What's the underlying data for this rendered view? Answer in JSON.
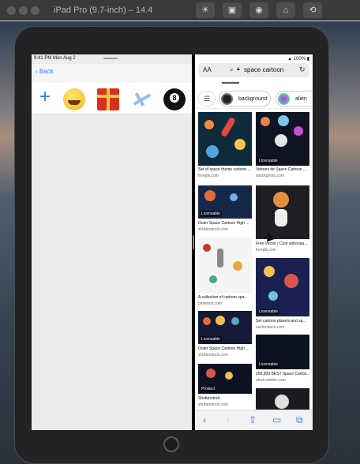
{
  "simulator": {
    "title": "iPad Pro (9.7-inch) – 14.4"
  },
  "left_app": {
    "status_time": "9:41 PM  Mon Aug 2",
    "back_label": "Back",
    "emoji_row": [
      {
        "icon": "plus-icon",
        "glyph": "+"
      },
      {
        "icon": "smile-emoji-icon"
      },
      {
        "icon": "gift-emoji-icon"
      },
      {
        "icon": "airplane-emoji-icon"
      },
      {
        "icon": "eight-ball-emoji-icon"
      }
    ]
  },
  "safari": {
    "status_right": "100%",
    "text_size_label": "AA",
    "search_value": "space cartoon",
    "chips": [
      {
        "label": "background"
      },
      {
        "label": "alien"
      }
    ],
    "results": [
      {
        "caption": "Set of space theme cartoon ...",
        "source": "freepik.com",
        "badge": ""
      },
      {
        "caption": "Vetores de Space Cartoon ...",
        "source": "istockphoto.com",
        "badge": "Licensable"
      },
      {
        "caption": "Outer Space Cartoon High ...",
        "source": "shutterstock.com",
        "badge": "Licensable"
      },
      {
        "caption": "Free Vector | Cute astronau...",
        "source": "freepik.com",
        "badge": ""
      },
      {
        "caption": "A collection of cartoon spa...",
        "source": "pinterest.com",
        "badge": ""
      },
      {
        "caption": "Set cartoon planets and sp...",
        "source": "vectorstock.com",
        "badge": "Licensable"
      },
      {
        "caption": "Outer Space Cartoon High ...",
        "source": "shutterstock.com",
        "badge": "Licensable"
      },
      {
        "caption": "258,909 BEST Space Cartoo...",
        "source": "stock.adobe.com",
        "badge": "Licensable"
      },
      {
        "caption": "Shutterstock",
        "source": "shutterstock.com",
        "badge": "Product"
      }
    ]
  },
  "colors": {
    "accent": "#2f7cf6",
    "tile_bg": "#10192d"
  }
}
